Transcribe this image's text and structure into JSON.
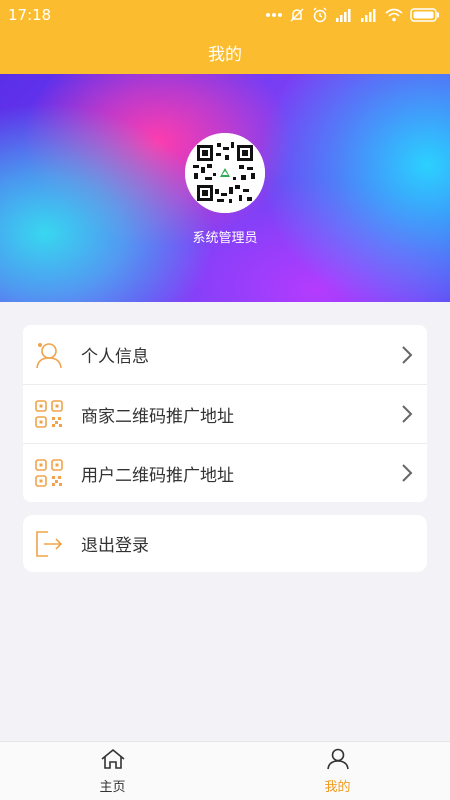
{
  "status_bar": {
    "time": "17:18",
    "battery": ""
  },
  "header": {
    "title": "我的"
  },
  "profile": {
    "name": "系统管理员"
  },
  "menu": {
    "items": [
      {
        "label": "个人信息",
        "icon": "user-info-icon"
      },
      {
        "label": "商家二维码推广地址",
        "icon": "qr-code-icon"
      },
      {
        "label": "用户二维码推广地址",
        "icon": "qr-code-icon"
      }
    ],
    "logout_label": "退出登录"
  },
  "tabbar": {
    "tabs": [
      {
        "label": "主页",
        "icon": "home-icon",
        "active": false
      },
      {
        "label": "我的",
        "icon": "profile-icon",
        "active": true
      }
    ]
  },
  "colors": {
    "header": "#fbbd2f",
    "accent": "#f29a1d",
    "background": "#f3f3f7"
  }
}
